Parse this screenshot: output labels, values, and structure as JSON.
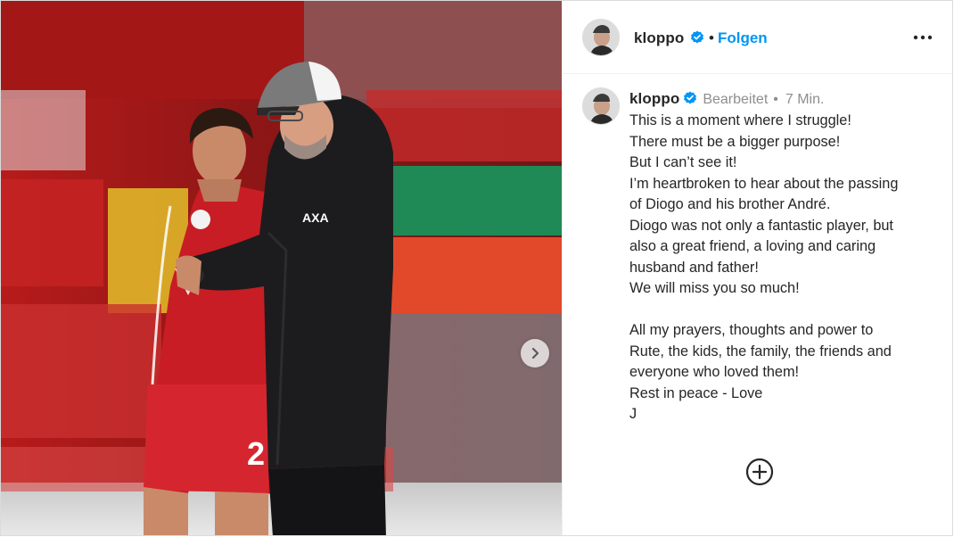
{
  "post": {
    "username": "kloppo",
    "follow_label": "Folgen",
    "dot": "•",
    "more_icon": "more-horizontal-icon",
    "verified_color": "#0095f6"
  },
  "comment": {
    "username": "kloppo",
    "edited_label": "Bearbeitet",
    "dot": "•",
    "time": "7 Min.",
    "lines": [
      "This is a moment where I struggle!",
      "There must be a bigger purpose!",
      "But I can’t see it!",
      "I’m heartbroken to hear about the passing",
      "of Diogo and his brother André.",
      "Diogo was not only a fantastic player, but",
      "also a great friend, a loving and caring",
      "husband and father!",
      "We will miss you so much!",
      "",
      "All my prayers, thoughts and power to",
      "Rute, the kids, the family, the friends and",
      "everyone who loved them!",
      "Rest in peace - Love",
      "J"
    ]
  },
  "photo": {
    "player_number": "2",
    "coach_cap_brand": "AXA"
  },
  "actions": {
    "add_icon": "add-circle-icon",
    "next_icon": "chevron-right-icon"
  }
}
